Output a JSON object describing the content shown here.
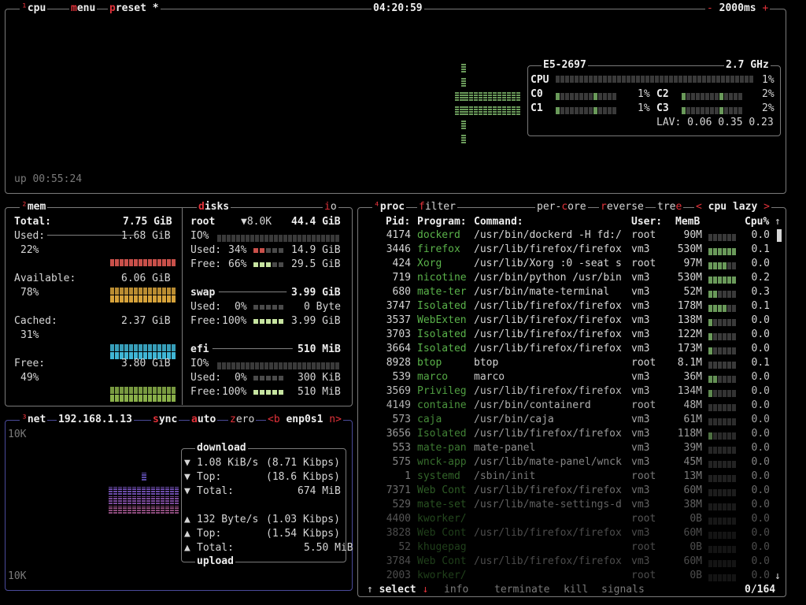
{
  "cpu_box": {
    "superscript": "¹",
    "title": "cpu",
    "menu_label": "menu",
    "preset_label": "preset",
    "preset_mark": "*",
    "clock": "04:20:59",
    "interval_minus": "-",
    "interval": "2000ms",
    "interval_plus": "+",
    "uptime": "up 00:55:24",
    "model": "E5-2697",
    "freq": "2.7 GHz",
    "cpu_label": "CPU",
    "cpu_pct": "1%",
    "cores": [
      {
        "label": "C0",
        "pct": "1%"
      },
      {
        "label": "C1",
        "pct": "1%"
      },
      {
        "label": "C2",
        "pct": "2%"
      },
      {
        "label": "C3",
        "pct": "2%"
      }
    ],
    "lav": "LAV: 0.06 0.35 0.23"
  },
  "mem_box": {
    "superscript": "²",
    "title": "mem",
    "total_label": "Total:",
    "total_value": "7.75 GiB",
    "used_label": "Used:",
    "used_value": "1.68 GiB",
    "used_pct": "22%",
    "available_label": "Available:",
    "available_value": "6.06 GiB",
    "available_pct": "78%",
    "cached_label": "Cached:",
    "cached_value": "2.37 GiB",
    "cached_pct": "31%",
    "free_label": "Free:",
    "free_value": "3.80 GiB",
    "free_pct": "49%",
    "colors": {
      "used": "#c9504a",
      "available": "#d6a23a",
      "cached": "#3fb6d6",
      "free": "#8ab04a"
    }
  },
  "disks_box": {
    "title": "disks",
    "io_label": "io",
    "root": {
      "name": "root",
      "speed": "▼8.0K",
      "total": "44.4 GiB",
      "io_label": "IO%",
      "used_label": "Used:",
      "used_pct": "34%",
      "used_value": "14.9 GiB",
      "free_label": "Free:",
      "free_pct": "66%",
      "free_value": "29.5 GiB"
    },
    "swap": {
      "name": "swap",
      "total": "3.99 GiB",
      "used_label": "Used:",
      "used_pct": "0%",
      "used_value": "0 Byte",
      "free_label": "Free:",
      "free_pct": "100%",
      "free_value": "3.99 GiB"
    },
    "efi": {
      "name": "efi",
      "total": "510 MiB",
      "io_label": "IO%",
      "used_label": "Used:",
      "used_pct": "0%",
      "used_value": "300 KiB",
      "free_label": "Free:",
      "free_pct": "100%",
      "free_value": "510 MiB"
    }
  },
  "net_box": {
    "superscript": "³",
    "title": "net",
    "ip": "192.168.1.13",
    "sync_label": "sync",
    "auto_label": "auto",
    "zero_label": "zero",
    "prev_iface": "<b",
    "iface": "enp0s1",
    "next_iface": "n>",
    "scale_top": "10K",
    "scale_bottom": "10K",
    "download_title": "download",
    "upload_title": "upload",
    "down_rate": "1.08 KiB/s",
    "down_rate_bits": "(8.71 Kibps)",
    "down_top_label": "Top:",
    "down_top": "(18.6 Kibps)",
    "down_total_label": "Total:",
    "down_total": "674 MiB",
    "up_rate": "132 Byte/s",
    "up_rate_bits": "(1.03 Kibps)",
    "up_top_label": "Top:",
    "up_top": "(1.54 Kibps)",
    "up_total_label": "Total:",
    "up_total": "5.50 MiB",
    "down_arrow": "▼",
    "up_arrow": "▲"
  },
  "proc_box": {
    "superscript": "⁴",
    "title": "proc",
    "filter_label": "filter",
    "per_core_label": "per-core",
    "reverse_label": "reverse",
    "tree_label": "tree",
    "sort_prev": "<",
    "sort_label": "cpu lazy",
    "sort_next": ">",
    "headers": {
      "pid": "Pid:",
      "program": "Program:",
      "command": "Command:",
      "user": "User:",
      "mem": "MemB",
      "cpu": "Cpu%"
    },
    "rows": [
      {
        "pid": "4174",
        "program": "dockerd",
        "command": "/usr/bin/dockerd -H fd:/",
        "user": "root",
        "mem": "90M",
        "cpu": "0.0",
        "bar": 0.0
      },
      {
        "pid": "3446",
        "program": "firefox",
        "command": "/usr/lib/firefox/firefox",
        "user": "vm3",
        "mem": "530M",
        "cpu": "0.1",
        "bar": 1.0
      },
      {
        "pid": "424",
        "program": "Xorg",
        "command": "/usr/lib/Xorg :0 -seat s",
        "user": "root",
        "mem": "97M",
        "cpu": "0.0",
        "bar": 0.6
      },
      {
        "pid": "719",
        "program": "nicotine",
        "command": "/usr/bin/python /usr/bin",
        "user": "vm3",
        "mem": "530M",
        "cpu": "0.2",
        "bar": 1.0
      },
      {
        "pid": "680",
        "program": "mate-ter",
        "command": "/usr/bin/mate-terminal",
        "user": "vm3",
        "mem": "52M",
        "cpu": "0.3",
        "bar": 0.4
      },
      {
        "pid": "3747",
        "program": "Isolated",
        "command": "/usr/lib/firefox/firefox",
        "user": "vm3",
        "mem": "178M",
        "cpu": "0.1",
        "bar": 0.7
      },
      {
        "pid": "3537",
        "program": "WebExten",
        "command": "/usr/lib/firefox/firefox",
        "user": "vm3",
        "mem": "138M",
        "cpu": "0.0",
        "bar": 0.2
      },
      {
        "pid": "3703",
        "program": "Isolated",
        "command": "/usr/lib/firefox/firefox",
        "user": "vm3",
        "mem": "122M",
        "cpu": "0.0",
        "bar": 0.2
      },
      {
        "pid": "3664",
        "program": "Isolated",
        "command": "/usr/lib/firefox/firefox",
        "user": "vm3",
        "mem": "173M",
        "cpu": "0.0",
        "bar": 0.2
      },
      {
        "pid": "8928",
        "program": "btop",
        "command": "btop",
        "user": "root",
        "mem": "8.1M",
        "cpu": "0.1",
        "bar": 0.0
      },
      {
        "pid": "539",
        "program": "marco",
        "command": "marco",
        "user": "vm3",
        "mem": "36M",
        "cpu": "0.0",
        "bar": 0.4
      },
      {
        "pid": "3569",
        "program": "Privileg",
        "command": "/usr/lib/firefox/firefox",
        "user": "vm3",
        "mem": "134M",
        "cpu": "0.0",
        "bar": 0.2
      },
      {
        "pid": "4149",
        "program": "containe",
        "command": "/usr/bin/containerd",
        "user": "root",
        "mem": "48M",
        "cpu": "0.0",
        "bar": 0.0
      },
      {
        "pid": "573",
        "program": "caja",
        "command": "/usr/bin/caja",
        "user": "vm3",
        "mem": "61M",
        "cpu": "0.0",
        "bar": 0.0
      },
      {
        "pid": "3656",
        "program": "Isolated",
        "command": "/usr/lib/firefox/firefox",
        "user": "vm3",
        "mem": "118M",
        "cpu": "0.0",
        "bar": 0.2
      },
      {
        "pid": "553",
        "program": "mate-pan",
        "command": "mate-panel",
        "user": "vm3",
        "mem": "39M",
        "cpu": "0.0",
        "bar": 0.0
      },
      {
        "pid": "575",
        "program": "wnck-app",
        "command": "/usr/lib/mate-panel/wnck",
        "user": "vm3",
        "mem": "45M",
        "cpu": "0.0",
        "bar": 0.0
      },
      {
        "pid": "1",
        "program": "systemd",
        "command": "/sbin/init",
        "user": "root",
        "mem": "13M",
        "cpu": "0.0",
        "bar": 0.0
      },
      {
        "pid": "7371",
        "program": "Web Cont",
        "command": "/usr/lib/firefox/firefox",
        "user": "vm3",
        "mem": "60M",
        "cpu": "0.0",
        "bar": 0.0
      },
      {
        "pid": "529",
        "program": "mate-set",
        "command": "/usr/lib/mate-settings-d",
        "user": "vm3",
        "mem": "38M",
        "cpu": "0.0",
        "bar": 0.0
      },
      {
        "pid": "4400",
        "program": "kworker/",
        "command": "",
        "user": "root",
        "mem": "0B",
        "cpu": "0.0",
        "bar": 0.0
      },
      {
        "pid": "3828",
        "program": "Web Cont",
        "command": "/usr/lib/firefox/firefox",
        "user": "vm3",
        "mem": "60M",
        "cpu": "0.0",
        "bar": 0.0
      },
      {
        "pid": "52",
        "program": "khugepag",
        "command": "",
        "user": "root",
        "mem": "0B",
        "cpu": "0.0",
        "bar": 0.0
      },
      {
        "pid": "3784",
        "program": "Web Cont",
        "command": "/usr/lib/firefox/firefox",
        "user": "vm3",
        "mem": "60M",
        "cpu": "0.0",
        "bar": 0.0
      },
      {
        "pid": "2003",
        "program": "kworker/",
        "command": "",
        "user": "root",
        "mem": "0B",
        "cpu": "0.0",
        "bar": 0.0
      }
    ],
    "footer": {
      "up_arrow": "↑",
      "select_label": "select",
      "down_arrow": "↓",
      "info_label": "info",
      "terminate_label": "terminate",
      "kill_label": "kill",
      "signals_label": "signals",
      "count": "0/164"
    },
    "scroll_up": "↑",
    "scroll_down": "↓"
  }
}
